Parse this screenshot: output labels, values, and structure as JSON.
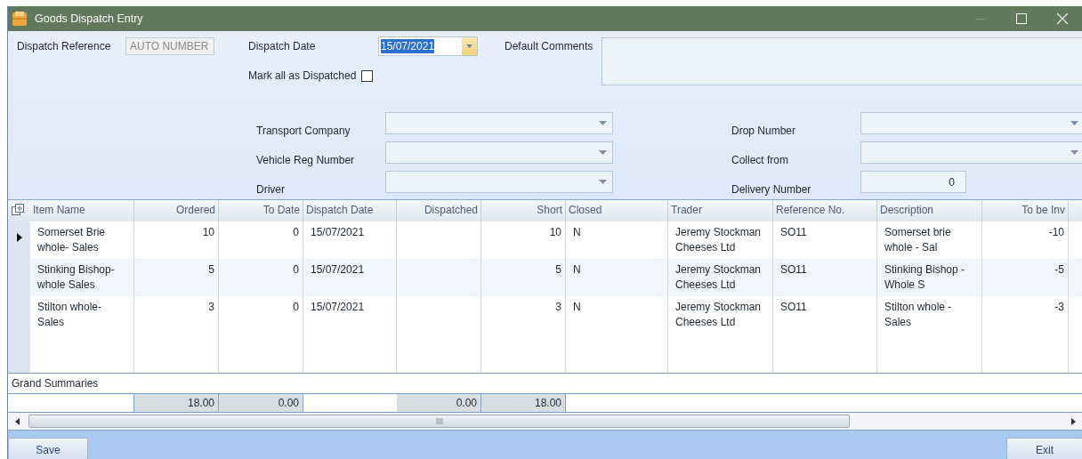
{
  "window": {
    "title": "Goods Dispatch Entry"
  },
  "form": {
    "dispatch_reference": {
      "label": "Dispatch Reference",
      "value": "AUTO NUMBER",
      "disabled": true
    },
    "dispatch_date": {
      "label": "Dispatch Date",
      "value": "15/07/2021",
      "text_selected": true
    },
    "default_comments": {
      "label": "Default Comments"
    },
    "mark_all_dispatched": {
      "label": "Mark all as Dispatched",
      "checked": false
    },
    "transport_company": {
      "label": "Transport Company"
    },
    "vehicle_reg_number": {
      "label": "Vehicle Reg Number"
    },
    "driver": {
      "label": "Driver"
    },
    "drop_number": {
      "label": "Drop Number"
    },
    "collect_from": {
      "label": "Collect from"
    },
    "delivery_number": {
      "label": "Delivery Number",
      "value": "0"
    }
  },
  "table": {
    "columns": [
      {
        "label": "Item Name",
        "kind": "text"
      },
      {
        "label": "Ordered",
        "kind": "number",
        "total": "18.00"
      },
      {
        "label": "To Date",
        "kind": "number",
        "total": "0.00"
      },
      {
        "label": "Dispatch Date",
        "kind": "text"
      },
      {
        "label": "Dispatched",
        "kind": "number",
        "total": "0.00"
      },
      {
        "label": "Short",
        "kind": "number",
        "total": "18.00"
      },
      {
        "label": "Closed",
        "kind": "text"
      },
      {
        "label": "Trader",
        "kind": "text"
      },
      {
        "label": "Reference No.",
        "kind": "text"
      },
      {
        "label": "Description",
        "kind": "text"
      },
      {
        "label": "To be Inv",
        "kind": "number"
      }
    ],
    "rows": [
      {
        "current": true,
        "cells": [
          "Somerset Brie whole- Sales",
          "10",
          "0",
          "15/07/2021",
          null,
          "10",
          "N",
          "Jeremy Stockman Cheeses Ltd",
          "SO11",
          "Somerset brie whole - Sal",
          "-10"
        ]
      },
      {
        "current": false,
        "cells": [
          "Stinking Bishop- whole Sales",
          "5",
          "0",
          "15/07/2021",
          null,
          "5",
          "N",
          "Jeremy Stockman Cheeses Ltd",
          "SO11",
          "Stinking Bishop - Whole S",
          "-5"
        ]
      },
      {
        "current": false,
        "cells": [
          "Stilton whole- Sales",
          "3",
          "0",
          "15/07/2021",
          null,
          "3",
          "N",
          "Jeremy Stockman Cheeses Ltd",
          "SO11",
          "Stilton whole - Sales",
          "-3"
        ]
      }
    ],
    "summary_label": "Grand Summaries"
  },
  "buttons": [
    {
      "label": "Save",
      "kind": "left"
    },
    {
      "label": "Exit",
      "kind": "right"
    }
  ]
}
